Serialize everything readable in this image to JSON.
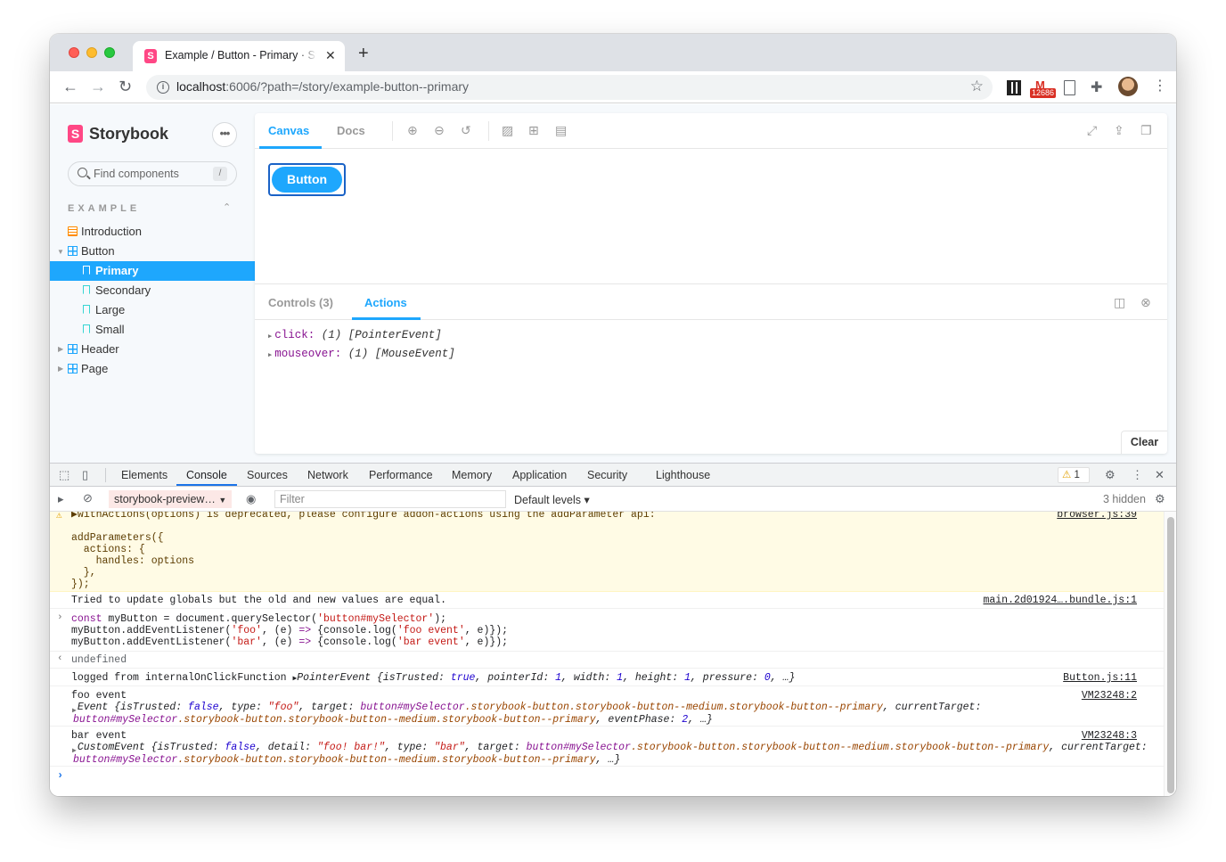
{
  "browser": {
    "tab_title": "Example / Button - Primary · Storybook",
    "url_host": "localhost",
    "url_rest": ":6006/?path=/story/example-button--primary",
    "gmail_badge": "12686"
  },
  "sidebar": {
    "brand": "Storybook",
    "search_placeholder": "Find components",
    "search_shortcut": "/",
    "section": "EXAMPLE",
    "items": [
      {
        "label": "Introduction"
      },
      {
        "label": "Button"
      },
      {
        "label": "Primary"
      },
      {
        "label": "Secondary"
      },
      {
        "label": "Large"
      },
      {
        "label": "Small"
      },
      {
        "label": "Header"
      },
      {
        "label": "Page"
      }
    ]
  },
  "preview": {
    "tabs": [
      "Canvas",
      "Docs"
    ],
    "button_label": "Button",
    "addon_tabs": [
      "Controls (3)",
      "Actions"
    ],
    "actions": [
      {
        "name": "click:",
        "args": "(1) [PointerEvent]"
      },
      {
        "name": "mouseover:",
        "args": "(1) [MouseEvent]"
      }
    ],
    "clear_label": "Clear"
  },
  "devtools": {
    "tabs": [
      "Elements",
      "Console",
      "Sources",
      "Network",
      "Performance",
      "Memory",
      "Application",
      "Security",
      "Lighthouse"
    ],
    "warning_count": "1",
    "context": "storybook-preview…",
    "filter_placeholder": "Filter",
    "levels": "Default levels ▾",
    "hidden": "3 hidden",
    "messages": {
      "warn_head": "▶withActions(options) is deprecated, please configure addon-actions using the addParameter api:",
      "warn_body": "addParameters({\n  actions: {\n    handles: options\n  },\n});",
      "warn_src": "browser.js:39",
      "globals": "Tried to update globals but the old and new values are equal.",
      "globals_src": "main.2d01924….bundle.js:1",
      "undefined": "undefined",
      "logged_src": "Button.js:11",
      "foo_label": "foo event",
      "foo_src": "VM23248:2",
      "bar_label": "bar event",
      "bar_src": "VM23248:3"
    }
  }
}
